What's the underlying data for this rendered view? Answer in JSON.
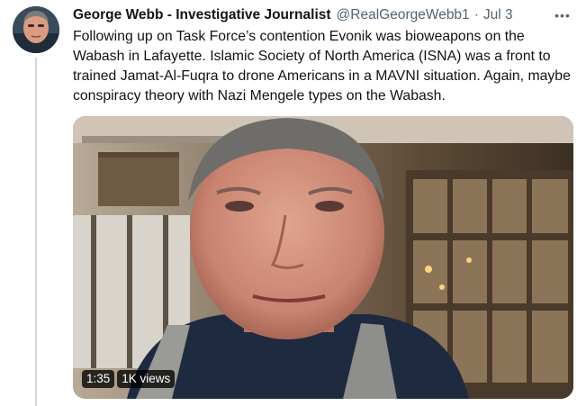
{
  "tweet": {
    "author_name": "George Webb - Investigative Journalist",
    "handle": "@RealGeorgeWebb1",
    "separator": "·",
    "date": "Jul 3",
    "more_icon": "more-horizontal-icon",
    "text": "Following up on Task Force’s contention Evonik was bioweapons on the Wabash in Lafayette. Islamic Society of North America (ISNA) was a front to trained Jamat-Al-Fuqra to drone Americans in a MAVNI situation. Again, maybe conspiracy theory with Nazi Mengele types on the Wabash."
  },
  "video": {
    "duration": "1:35",
    "views": "1K views"
  }
}
